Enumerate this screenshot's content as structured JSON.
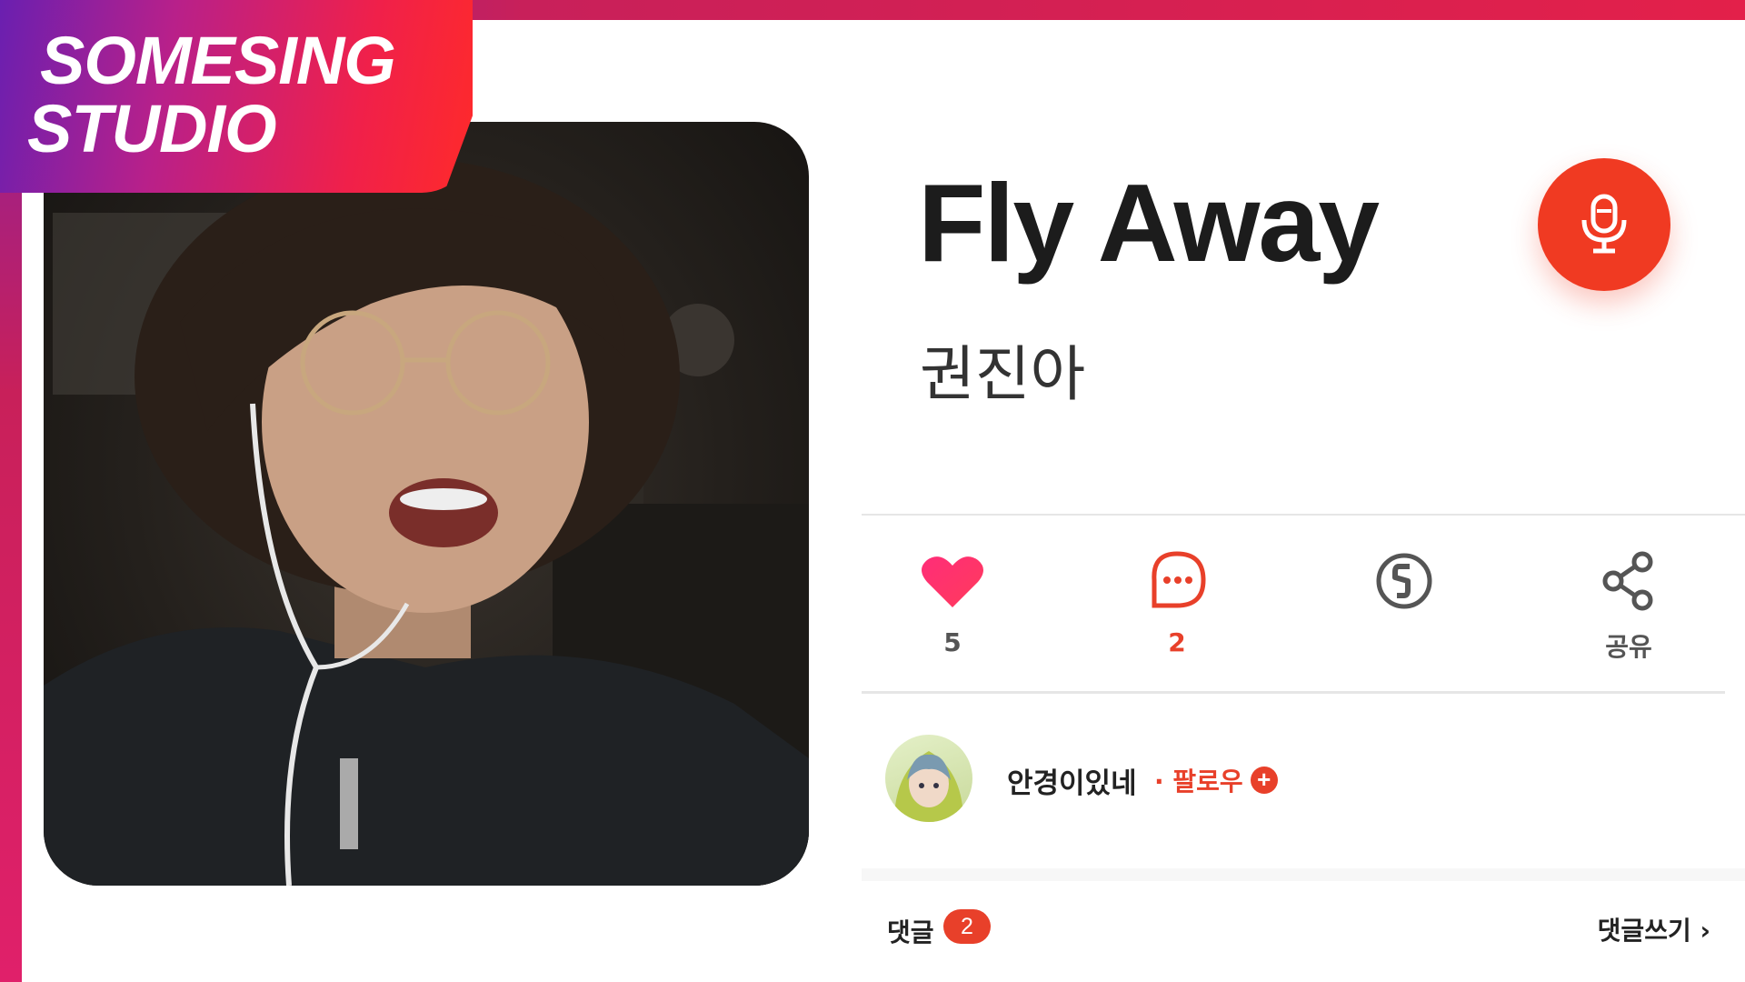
{
  "brand": {
    "line1": "SOMESING",
    "line2": "STUDIO"
  },
  "song": {
    "title": "Fly Away",
    "artist": "권진아"
  },
  "actions": {
    "likes": "5",
    "comments": "2",
    "share": "공유"
  },
  "user": {
    "name": "안경이있네",
    "follow": "· 팔로우",
    "follow_plus": "+"
  },
  "comments": {
    "label": "댓글",
    "count": "2",
    "write": "댓글쓰기 ›"
  },
  "colors": {
    "accent": "#e8402a",
    "heart": "#ff2d78",
    "mic": "#f03a22"
  }
}
